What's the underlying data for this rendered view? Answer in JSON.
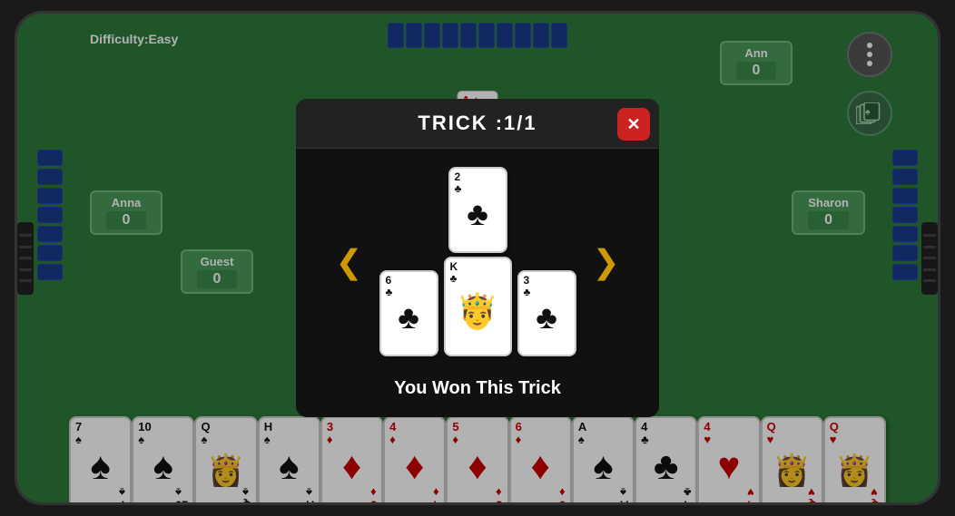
{
  "device": {
    "difficulty_label": "Difficulty:Easy",
    "options_btn_label": "⋮",
    "top_deck_count": 10
  },
  "players": {
    "ann": {
      "name": "Ann",
      "score": "0"
    },
    "anna": {
      "name": "Anna",
      "score": "0"
    },
    "guest": {
      "name": "Guest",
      "score": "0"
    },
    "sharon": {
      "name": "Sharon",
      "score": "0"
    }
  },
  "modal": {
    "title": "TRICK :1/1",
    "close_label": "✕",
    "result_text": "You Won This Trick",
    "nav_left": "❮",
    "nav_right": "❯",
    "cards": [
      {
        "rank": "6",
        "suit": "♣",
        "color": "black",
        "size": "small"
      },
      {
        "rank": "2",
        "suit": "♣",
        "color": "black",
        "size": "small"
      },
      {
        "rank": "3",
        "suit": "♣",
        "color": "black",
        "size": "small"
      },
      {
        "rank": "K",
        "suit": "♣",
        "color": "black",
        "size": "large",
        "is_king": true
      }
    ]
  },
  "hand": {
    "cards": [
      {
        "rank": "7",
        "suit": "♠",
        "color": "black"
      },
      {
        "rank": "10",
        "suit": "♠",
        "color": "black"
      },
      {
        "rank": "Q",
        "suit": "♠",
        "color": "black"
      },
      {
        "rank": "H",
        "suit": "♠",
        "color": "black"
      },
      {
        "rank": "3",
        "suit": "♦",
        "color": "red"
      },
      {
        "rank": "4",
        "suit": "♦",
        "color": "red"
      },
      {
        "rank": "5",
        "suit": "♦",
        "color": "red"
      },
      {
        "rank": "6",
        "suit": "♦",
        "color": "red"
      },
      {
        "rank": "A",
        "suit": "♠",
        "color": "black"
      },
      {
        "rank": "4",
        "suit": "♣",
        "color": "black"
      },
      {
        "rank": "4",
        "suit": "♥",
        "color": "red"
      },
      {
        "rank": "Q",
        "suit": "♥",
        "color": "red"
      },
      {
        "rank": "Q",
        "suit": "♥",
        "color": "red"
      }
    ]
  }
}
